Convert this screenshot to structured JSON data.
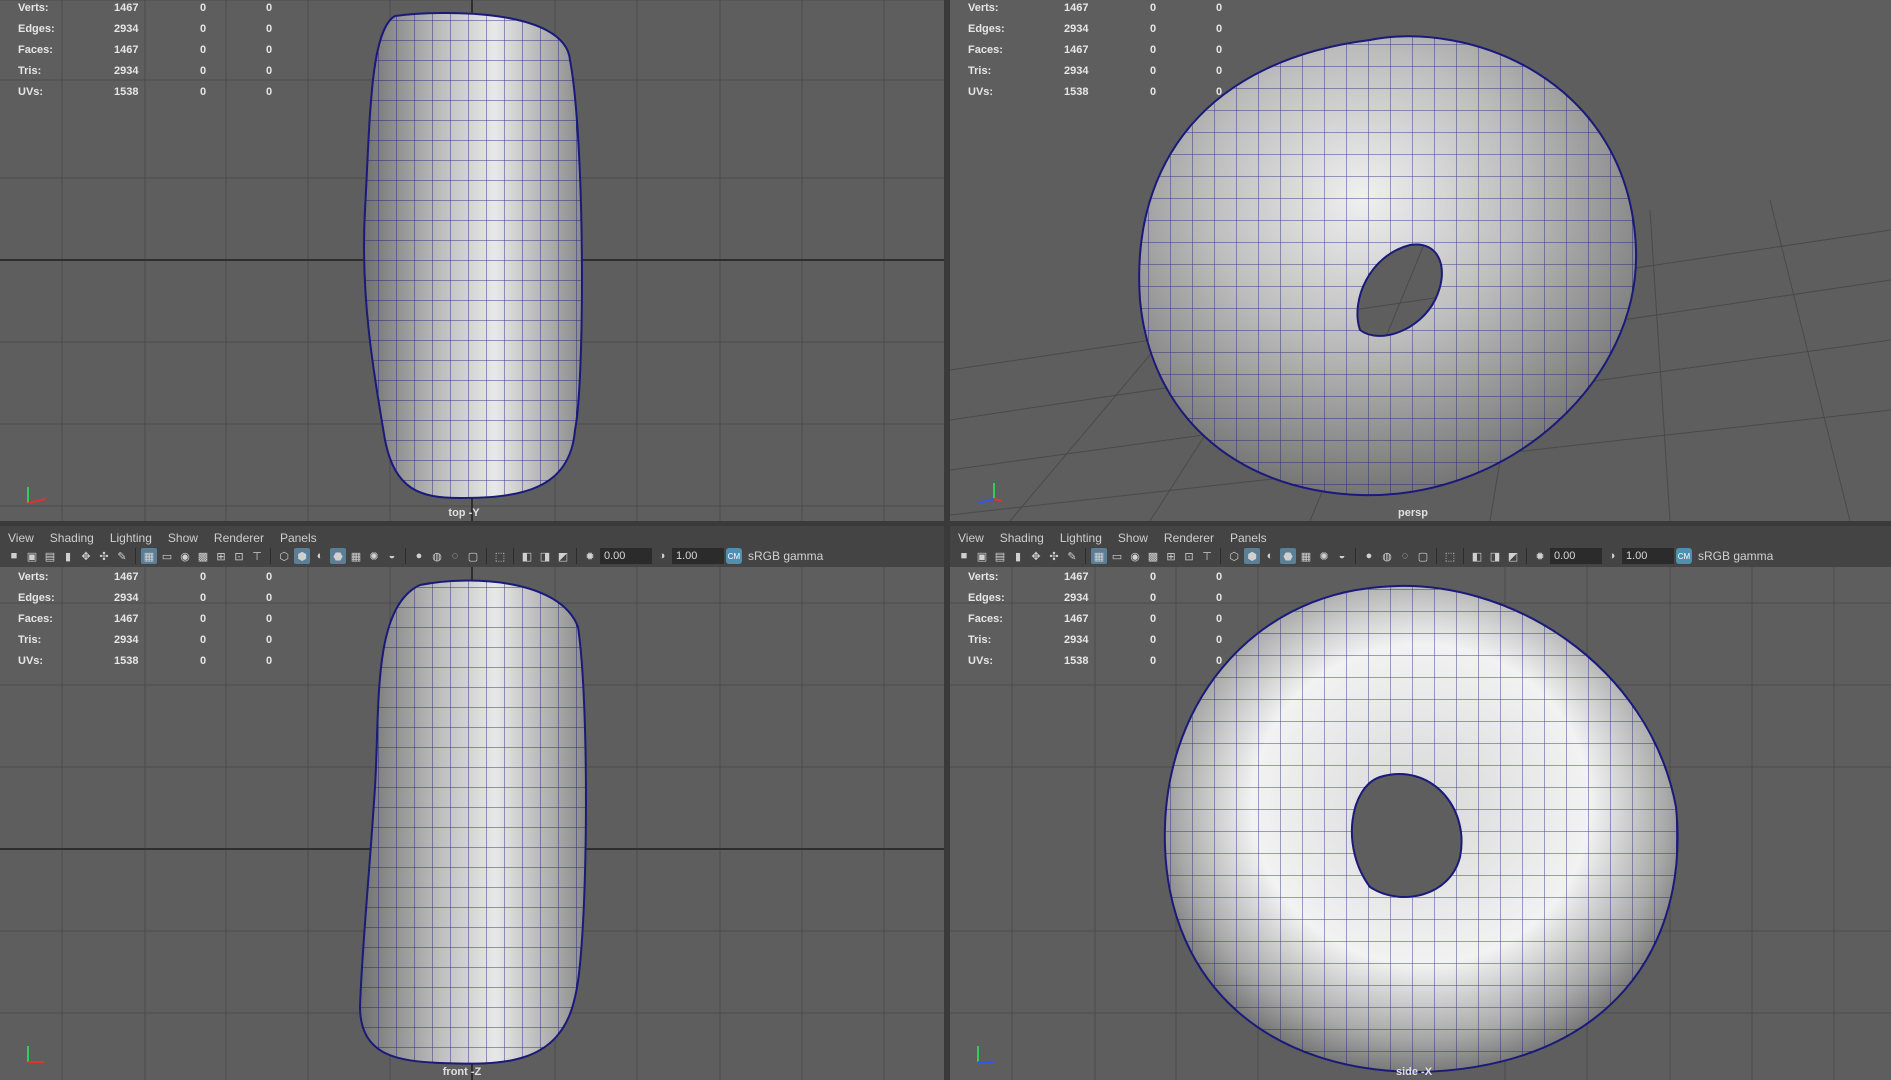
{
  "stats": [
    {
      "label": "Verts:",
      "a": "1467",
      "b": "0",
      "c": "0"
    },
    {
      "label": "Edges:",
      "a": "2934",
      "b": "0",
      "c": "0"
    },
    {
      "label": "Faces:",
      "a": "1467",
      "b": "0",
      "c": "0"
    },
    {
      "label": "Tris:",
      "a": "2934",
      "b": "0",
      "c": "0"
    },
    {
      "label": "UVs:",
      "a": "1538",
      "b": "0",
      "c": "0"
    }
  ],
  "panels": {
    "top": {
      "camera": "top -Y"
    },
    "persp": {
      "camera": "persp"
    },
    "front": {
      "camera": "front -Z"
    },
    "side": {
      "camera": "side -X"
    }
  },
  "menu": [
    "View",
    "Shading",
    "Lighting",
    "Show",
    "Renderer",
    "Panels"
  ],
  "toolbar": {
    "exposure": "0.00",
    "gamma": "1.00",
    "color_space": "sRGB gamma",
    "color_management_badge": "CM"
  },
  "colors": {
    "viewport_bg": "#5e5e5e",
    "grid_line": "#4c4c4c",
    "grid_axis": "#2e2e2e",
    "wire": "#1a1a7a",
    "mesh_light": "#d6d6d6",
    "mesh_dark": "#6a6a6a"
  }
}
